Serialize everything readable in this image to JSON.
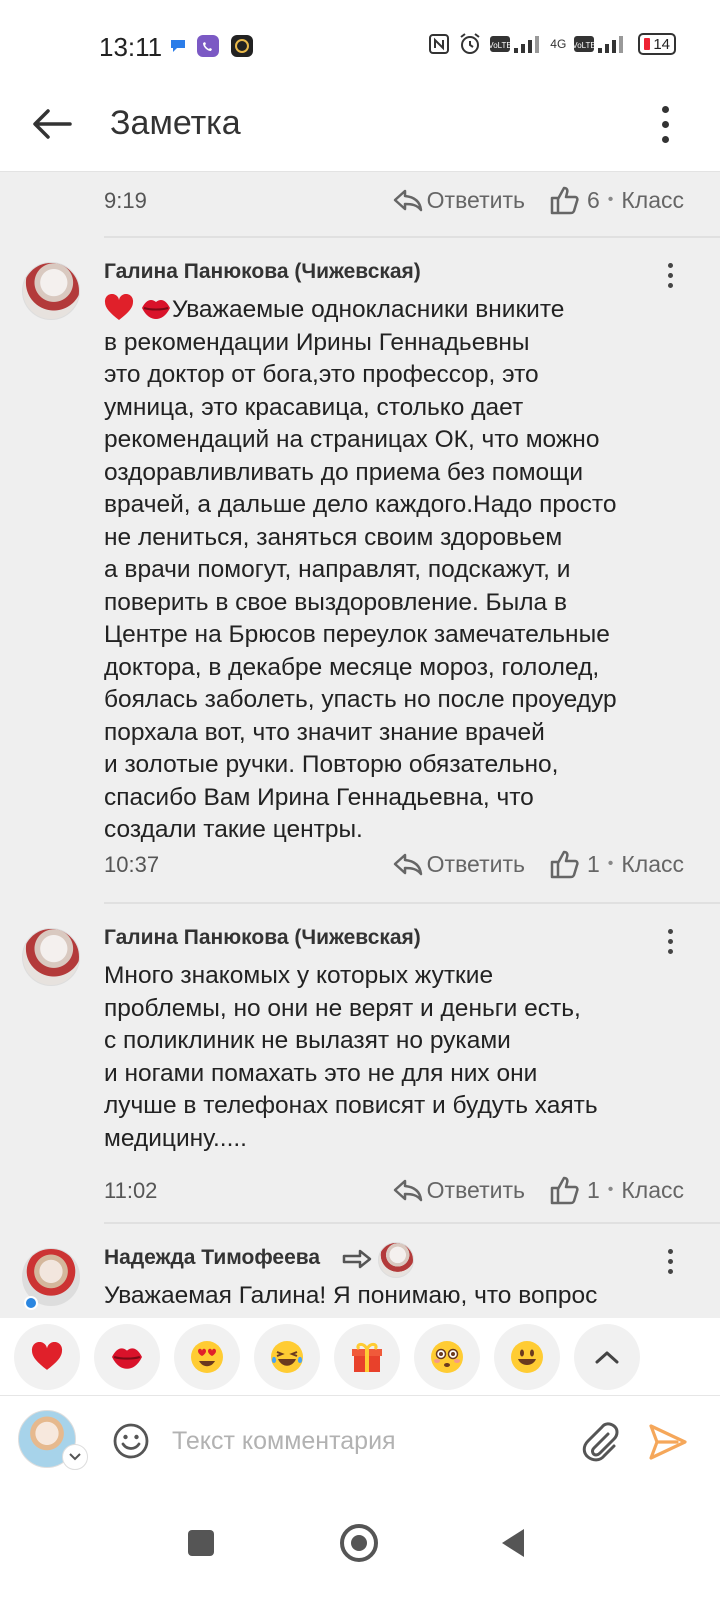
{
  "status_bar": {
    "time": "13:11",
    "network": "4G",
    "battery": "14"
  },
  "header": {
    "title": "Заметка"
  },
  "comments": [
    {
      "time": "9:19",
      "reply_label": "Ответить",
      "likes": "6",
      "klass_label": "Класс"
    },
    {
      "author": "Галина Панюкова (Чижевская)",
      "text": "Уважаемые однокласники вниките\nв рекомендации Ирины Геннадьевны\nэто доктор от бога,это профессор, это\nумница, это красавица, столько дает\nрекомендаций на страницах ОК, что можно\nоздоравливливать до приема без помощи\nврачей, а дальше дело каждого.Надо просто\nне лениться, заняться своим здоровьем\nа врачи помогут, направлят, подскажут, и\nповерить в свое выздоровление. Была в\nЦентре на Брюсов переулок замечательные\nдоктора, в декабре месяце мороз, гололед,\nбоялась заболеть, упасть но после проуедур\nпорхала вот, что значит знание врачей\nи золотые ручки. Повторю обязательно,\nспасибо Вам Ирина Геннадьевна, что\nсоздали такие центры.",
      "time": "10:37",
      "reply_label": "Ответить",
      "likes": "1",
      "klass_label": "Класс"
    },
    {
      "author": "Галина Панюкова (Чижевская)",
      "text": "Много знакомых у которых жуткие\nпроблемы, но они не верят и деньги есть,\nс поликлиник не вылазят но руками\nи ногами помахать это не для них они\nлучше в телефонах повисят и будуть хаять\nмедицину.....",
      "time": "11:02",
      "reply_label": "Ответить",
      "likes": "1",
      "klass_label": "Класс"
    },
    {
      "author": "Надежда Тимофеева",
      "text": "Уважаемая Галина! Я понимаю, что вопрос"
    }
  ],
  "reactions": [
    "heart",
    "lips",
    "heart-eyes",
    "laughing",
    "gift",
    "flushed",
    "smiley",
    "expand"
  ],
  "input": {
    "placeholder": "Текст комментария"
  },
  "colors": {
    "accent": "#ee8208",
    "background": "#efefef"
  }
}
